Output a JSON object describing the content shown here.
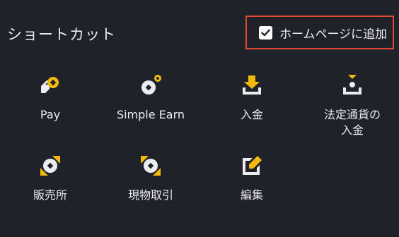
{
  "header": {
    "title": "ショートカット",
    "home_toggle": {
      "label": "ホームページに追加",
      "checked": true
    }
  },
  "shortcuts": [
    {
      "label": "Pay",
      "icon": "pay-icon"
    },
    {
      "label": "Simple Earn",
      "icon": "simple-earn-icon"
    },
    {
      "label": "入金",
      "icon": "deposit-icon"
    },
    {
      "label": "法定通貨の\n入金",
      "icon": "fiat-deposit-icon"
    },
    {
      "label": "販売所",
      "icon": "convert-icon"
    },
    {
      "label": "現物取引",
      "icon": "spot-trade-icon"
    },
    {
      "label": "編集",
      "icon": "edit-icon"
    }
  ],
  "colors": {
    "background": "#1f2228",
    "accent_yellow": "#f0b90b",
    "icon_white": "#eaecef",
    "highlight_border": "#e0492f"
  }
}
